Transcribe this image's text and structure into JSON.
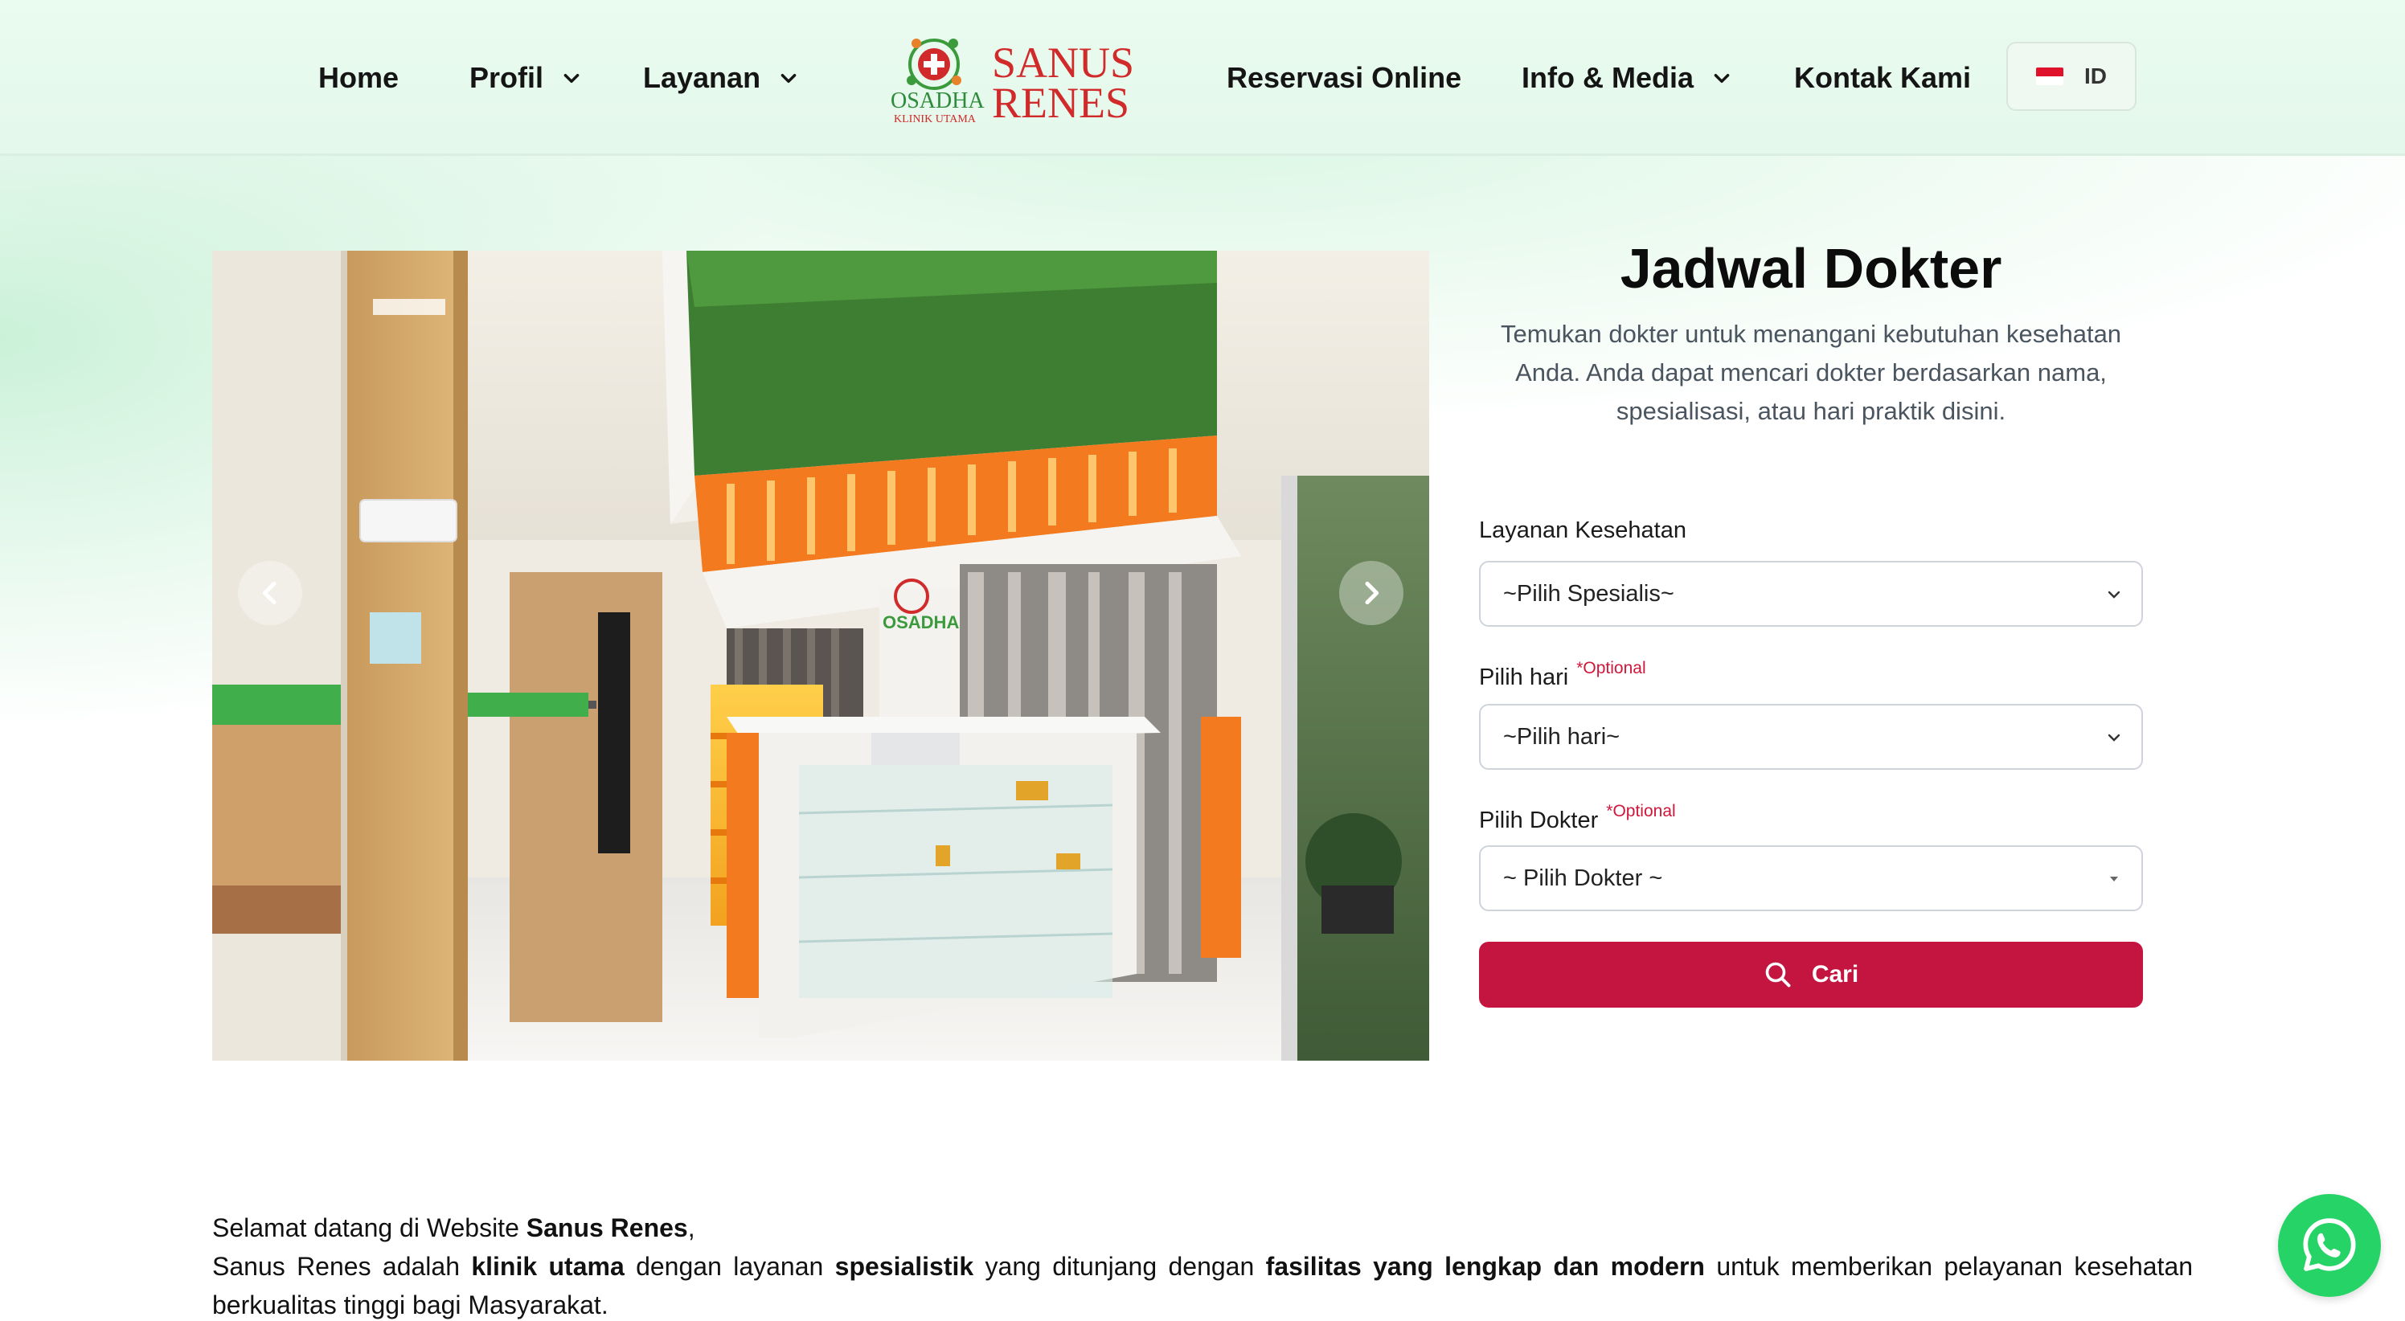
{
  "nav": {
    "home": "Home",
    "profil": "Profil",
    "layanan": "Layanan",
    "reservasi": "Reservasi Online",
    "info_media": "Info & Media",
    "kontak": "Kontak Kami",
    "lang": "ID"
  },
  "logo": {
    "brand_top": "SANUS",
    "brand_bottom": "RENES",
    "sub_top": "OSADHA",
    "sub_bottom": "KLINIK UTAMA"
  },
  "jadwal": {
    "title": "Jadwal Dokter",
    "subtitle": "Temukan dokter untuk menangani kebutuhan kesehatan Anda. Anda dapat mencari dokter berdasarkan nama, spesialisasi, atau hari praktik disini.",
    "layanan_label": "Layanan Kesehatan",
    "layanan_value": "~Pilih Spesialis~",
    "hari_label": "Pilih hari",
    "hari_optional": "*Optional",
    "hari_value": "~Pilih hari~",
    "dokter_label": "Pilih Dokter",
    "dokter_optional": "*Optional",
    "dokter_value": "~ Pilih Dokter ~",
    "button_label": "Cari"
  },
  "hero_image": {
    "sign_text": "OSADHA"
  },
  "welcome": {
    "line1_prefix": "Selamat datang di Website ",
    "line1_bold": "Sanus Renes",
    "line1_suffix": ",",
    "p2_a": "Sanus Renes adalah ",
    "p2_b": "klinik utama",
    "p2_c": " dengan layanan ",
    "p2_d": "spesialistik",
    "p2_e": " yang ditunjang dengan ",
    "p2_f": "fasilitas yang lengkap dan modern",
    "p2_g": " untuk memberikan pelayanan kesehatan berkualitas tinggi bagi Masyarakat."
  },
  "colors": {
    "primary_button": "#c3153f",
    "brand_red": "#d12a2a",
    "brand_green": "#3b9a3b",
    "optional_red": "#d0163a",
    "whatsapp": "#25d366"
  },
  "icons": {
    "dropdown": "chevron-down-icon",
    "carousel_prev": "chevron-left-icon",
    "carousel_next": "chevron-right-icon",
    "search": "search-icon",
    "whatsapp": "whatsapp-icon",
    "flag": "indonesia-flag-icon"
  }
}
